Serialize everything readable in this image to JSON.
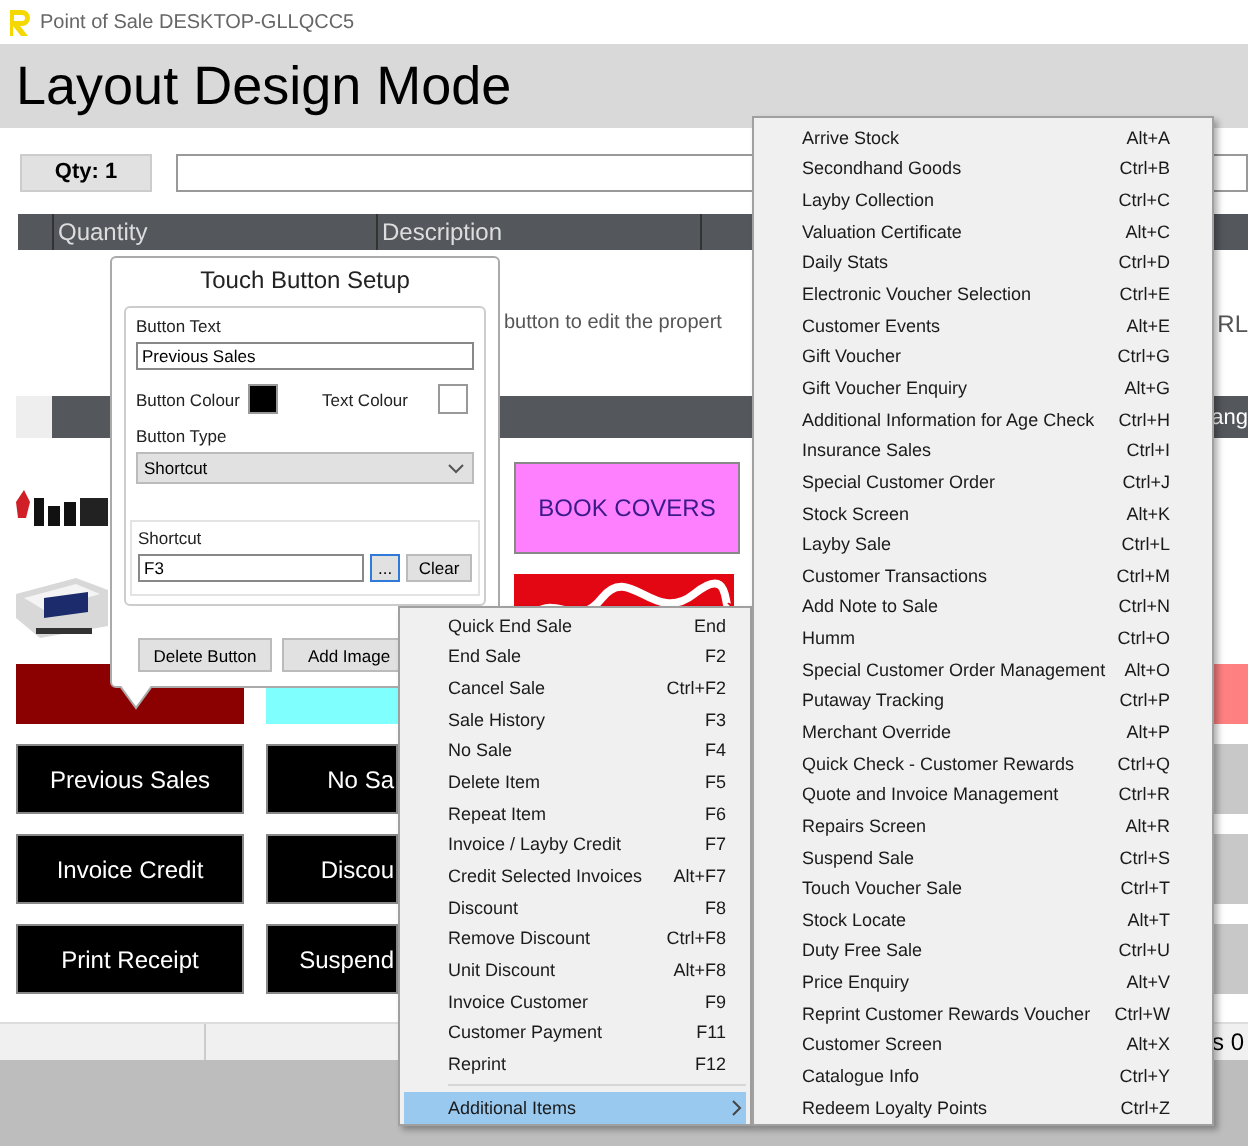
{
  "window": {
    "title": "Point of Sale DESKTOP-GLLQCC5"
  },
  "header": {
    "title": "Layout Design Mode"
  },
  "qty_button": {
    "label": "Qty: 1"
  },
  "table": {
    "columns": [
      "Quantity",
      "Description"
    ]
  },
  "hint_texts": [
    "button to edit the propert",
    "RL"
  ],
  "category_bar": {
    "text": "ang"
  },
  "tiles": [
    {
      "kind": "picture"
    },
    {
      "kind": "label",
      "label": "BOOK COVERS",
      "color": "#ff80ff"
    },
    {
      "kind": "picture"
    },
    {
      "kind": "picture"
    },
    {
      "kind": "blank",
      "color": "#8b0000"
    },
    {
      "kind": "blank",
      "color": "#80ffff"
    },
    {
      "kind": "blank",
      "color": "#ff8080"
    },
    {
      "kind": "label",
      "label": "Previous Sales",
      "color": "#000000"
    },
    {
      "kind": "label",
      "label": "No Sa",
      "color": "#000000"
    },
    {
      "kind": "blank",
      "color": "#c8c8c8"
    },
    {
      "kind": "label",
      "label": "Invoice Credit",
      "color": "#000000"
    },
    {
      "kind": "label",
      "label": "Discou",
      "color": "#000000"
    },
    {
      "kind": "blank",
      "color": "#c8c8c8"
    },
    {
      "kind": "label",
      "label": "Print Receipt",
      "color": "#000000"
    },
    {
      "kind": "label",
      "label": "Suspend",
      "color": "#000000"
    },
    {
      "kind": "blank",
      "color": "#c8c8c8"
    }
  ],
  "status_bar": {
    "text": "s 0"
  },
  "dialog": {
    "title": "Touch Button Setup",
    "button_text": {
      "label": "Button Text",
      "value": "Previous Sales"
    },
    "colours": [
      {
        "label": "Button Colour",
        "color": "#000000"
      },
      {
        "label": "Text Colour",
        "color": "#ffffff"
      }
    ],
    "button_type": {
      "label": "Button Type",
      "value": "Shortcut"
    },
    "shortcut": {
      "label": "Shortcut",
      "value": "F3",
      "browse": "...",
      "clear": "Clear"
    },
    "buttons": [
      "Delete Button",
      "Add Image"
    ]
  },
  "menu": {
    "items": [
      {
        "kind": "command",
        "label": "Quick End Sale",
        "shortcut": "End",
        "selected": false
      },
      {
        "kind": "command",
        "label": "End Sale",
        "shortcut": "F2",
        "selected": false
      },
      {
        "kind": "command",
        "label": "Cancel Sale",
        "shortcut": "Ctrl+F2",
        "selected": false
      },
      {
        "kind": "command",
        "label": "Sale History",
        "shortcut": "F3",
        "selected": false
      },
      {
        "kind": "command",
        "label": "No Sale",
        "shortcut": "F4",
        "selected": false
      },
      {
        "kind": "command",
        "label": "Delete Item",
        "shortcut": "F5",
        "selected": false
      },
      {
        "kind": "command",
        "label": "Repeat Item",
        "shortcut": "F6",
        "selected": false
      },
      {
        "kind": "command",
        "label": "Invoice / Layby Credit",
        "shortcut": "F7",
        "selected": false
      },
      {
        "kind": "command",
        "label": "Credit Selected Invoices",
        "shortcut": "Alt+F7",
        "selected": false
      },
      {
        "kind": "command",
        "label": "Discount",
        "shortcut": "F8",
        "selected": false
      },
      {
        "kind": "command",
        "label": "Remove Discount",
        "shortcut": "Ctrl+F8",
        "selected": false
      },
      {
        "kind": "command",
        "label": "Unit Discount",
        "shortcut": "Alt+F8",
        "selected": false
      },
      {
        "kind": "command",
        "label": "Invoice Customer",
        "shortcut": "F9",
        "selected": false
      },
      {
        "kind": "command",
        "label": "Customer Payment",
        "shortcut": "F11",
        "selected": false
      },
      {
        "kind": "command",
        "label": "Reprint",
        "shortcut": "F12",
        "selected": false
      },
      {
        "kind": "separator"
      },
      {
        "kind": "submenu",
        "label": "Additional Items",
        "selected": true
      }
    ]
  },
  "submenu": {
    "items": [
      {
        "label": "Arrive Stock",
        "shortcut": "Alt+A"
      },
      {
        "label": "Secondhand Goods",
        "shortcut": "Ctrl+B"
      },
      {
        "label": "Layby Collection",
        "shortcut": "Ctrl+C"
      },
      {
        "label": "Valuation Certificate",
        "shortcut": "Alt+C"
      },
      {
        "label": "Daily Stats",
        "shortcut": "Ctrl+D"
      },
      {
        "label": "Electronic Voucher Selection",
        "shortcut": "Ctrl+E"
      },
      {
        "label": "Customer Events",
        "shortcut": "Alt+E"
      },
      {
        "label": "Gift Voucher",
        "shortcut": "Ctrl+G"
      },
      {
        "label": "Gift Voucher Enquiry",
        "shortcut": "Alt+G"
      },
      {
        "label": "Additional Information for Age Check",
        "shortcut": "Ctrl+H"
      },
      {
        "label": "Insurance Sales",
        "shortcut": "Ctrl+I"
      },
      {
        "label": "Special Customer Order",
        "shortcut": "Ctrl+J"
      },
      {
        "label": "Stock Screen",
        "shortcut": "Alt+K"
      },
      {
        "label": "Layby Sale",
        "shortcut": "Ctrl+L"
      },
      {
        "label": "Customer Transactions",
        "shortcut": "Ctrl+M"
      },
      {
        "label": "Add Note to Sale",
        "shortcut": "Ctrl+N"
      },
      {
        "label": "Humm",
        "shortcut": "Ctrl+O"
      },
      {
        "label": "Special Customer Order Management",
        "shortcut": "Alt+O"
      },
      {
        "label": "Putaway Tracking",
        "shortcut": "Ctrl+P"
      },
      {
        "label": "Merchant Override",
        "shortcut": "Alt+P"
      },
      {
        "label": "Quick Check - Customer Rewards",
        "shortcut": "Ctrl+Q"
      },
      {
        "label": "Quote and Invoice Management",
        "shortcut": "Ctrl+R"
      },
      {
        "label": "Repairs Screen",
        "shortcut": "Alt+R"
      },
      {
        "label": "Suspend Sale",
        "shortcut": "Ctrl+S"
      },
      {
        "label": "Touch Voucher Sale",
        "shortcut": "Ctrl+T"
      },
      {
        "label": "Stock Locate",
        "shortcut": "Alt+T"
      },
      {
        "label": "Duty Free Sale",
        "shortcut": "Ctrl+U"
      },
      {
        "label": "Price Enquiry",
        "shortcut": "Alt+V"
      },
      {
        "label": "Reprint Customer Rewards Voucher",
        "shortcut": "Ctrl+W"
      },
      {
        "label": "Customer Screen",
        "shortcut": "Alt+X"
      },
      {
        "label": "Catalogue Info",
        "shortcut": "Ctrl+Y"
      },
      {
        "label": "Redeem Loyalty Points",
        "shortcut": "Ctrl+Z"
      }
    ]
  }
}
